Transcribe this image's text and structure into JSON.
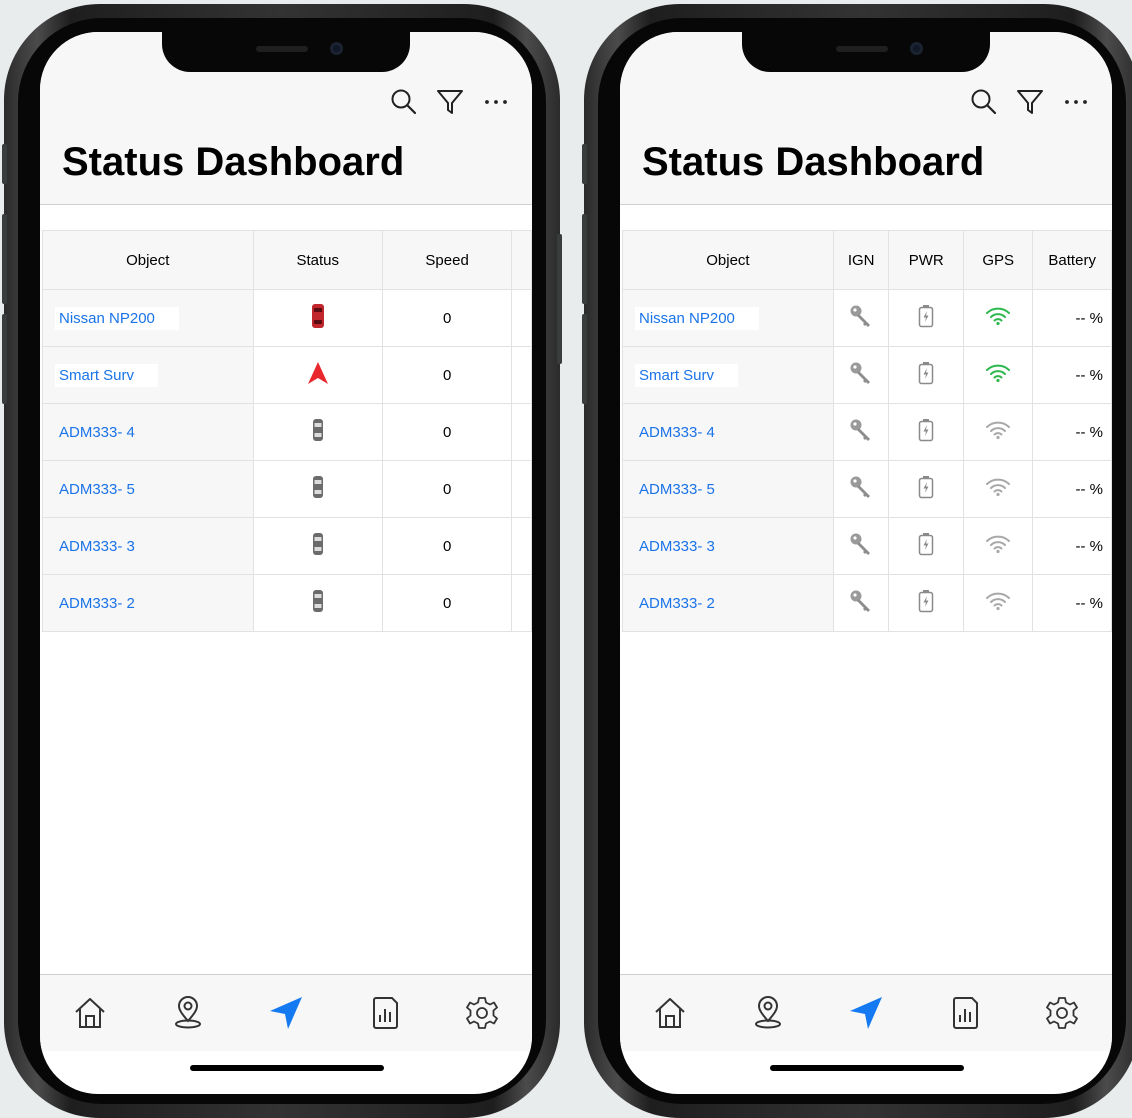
{
  "colors": {
    "link": "#1a73e8",
    "accent": "#1579f2",
    "gps_on": "#2db84d",
    "gps_off": "#a8a8a8",
    "arrow": "#e8282c"
  },
  "screens": [
    {
      "title": "Status Dashboard",
      "header_icons": [
        "search-icon",
        "filter-icon",
        "more-icon"
      ],
      "columns": [
        "Object",
        "Status",
        "Speed"
      ],
      "rows": [
        {
          "object": "Nissan NP200",
          "status": "red-car-icon",
          "speed": "0"
        },
        {
          "object": "Smart Surv",
          "status": "red-arrow-icon",
          "speed": "0"
        },
        {
          "object": "ADM333- 4",
          "status": "grey-car-icon",
          "speed": "0"
        },
        {
          "object": "ADM333- 5",
          "status": "grey-car-icon",
          "speed": "0"
        },
        {
          "object": "ADM333- 3",
          "status": "grey-car-icon",
          "speed": "0"
        },
        {
          "object": "ADM333- 2",
          "status": "grey-car-icon",
          "speed": "0"
        }
      ],
      "tabs": [
        "home-icon",
        "map-pin-icon",
        "navigation-icon",
        "report-icon",
        "settings-icon"
      ],
      "active_tab": "navigation-icon"
    },
    {
      "title": "Status Dashboard",
      "header_icons": [
        "search-icon",
        "filter-icon",
        "more-icon"
      ],
      "columns": [
        "Object",
        "IGN",
        "PWR",
        "GPS",
        "Battery"
      ],
      "rows": [
        {
          "object": "Nissan NP200",
          "gps": "on",
          "battery": "-- %"
        },
        {
          "object": "Smart Surv",
          "gps": "on",
          "battery": "-- %"
        },
        {
          "object": "ADM333- 4",
          "gps": "off",
          "battery": "-- %"
        },
        {
          "object": "ADM333- 5",
          "gps": "off",
          "battery": "-- %"
        },
        {
          "object": "ADM333- 3",
          "gps": "off",
          "battery": "-- %"
        },
        {
          "object": "ADM333- 2",
          "gps": "off",
          "battery": "-- %"
        }
      ],
      "tabs": [
        "home-icon",
        "map-pin-icon",
        "navigation-icon",
        "report-icon",
        "settings-icon"
      ],
      "active_tab": "navigation-icon"
    }
  ]
}
